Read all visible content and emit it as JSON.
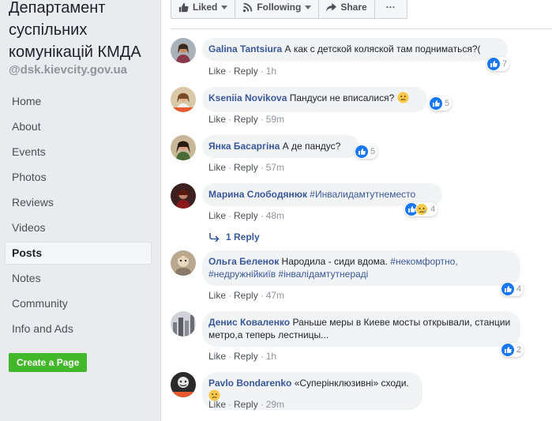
{
  "page": {
    "title": "Департамент суспільних комунікацій КМДА",
    "handle": "@dsk.kievcity.gov.ua"
  },
  "nav": {
    "home": "Home",
    "about": "About",
    "events": "Events",
    "photos": "Photos",
    "reviews": "Reviews",
    "videos": "Videos",
    "posts": "Posts",
    "notes": "Notes",
    "community": "Community",
    "info_ads": "Info and Ads",
    "active": "Posts"
  },
  "create_page_button": "Create a Page",
  "action_bar": {
    "liked": "Liked",
    "following": "Following",
    "share": "Share",
    "more": "···"
  },
  "colors": {
    "link": "#385898",
    "like_blue": "#1877f2",
    "create_green": "#42b72a",
    "bubble_bg": "#f2f3f5",
    "page_bg": "#e9ebee"
  },
  "comment_actions": {
    "like": "Like",
    "reply": "Reply",
    "separator": "·"
  },
  "comments": [
    {
      "author": "Galina Tantsiura",
      "text": "А как с детской коляской там подниматься?(",
      "time": "1h",
      "reactions": "7",
      "reaction_icons": [
        "like-icon"
      ]
    },
    {
      "author": "Kseniia Novikova",
      "text": "Пандуси не вписалися?",
      "time": "59m",
      "reactions": "5",
      "reaction_icons": [
        "like-icon"
      ],
      "emoji": "confused-face-emoji"
    },
    {
      "author": "Янка Басаргіна",
      "text": "А де пандус?",
      "time": "57m",
      "reactions": "5",
      "reaction_icons": [
        "like-icon"
      ]
    },
    {
      "author": "Марина Слободянюк",
      "tags": [
        "#Инвалидамтутнеместо"
      ],
      "time": "48m",
      "reactions": "4",
      "reaction_icons": [
        "like-icon",
        "sad-icon"
      ]
    },
    {
      "author": "Ольга Беленок",
      "text": "Народила - сиди вдома.",
      "tags": [
        "#некомфортно,",
        "#недружнійкиїв",
        "#інвалідамтутнераді"
      ],
      "time": "47m",
      "reactions": "4",
      "reaction_icons": [
        "like-icon"
      ]
    },
    {
      "author": "Денис Коваленко",
      "text": "Раньше меры в Киеве мосты открывали, станции метро,а теперь лестницы...",
      "time": "1h",
      "reactions": "2",
      "reaction_icons": [
        "like-icon"
      ]
    },
    {
      "author": "Pavlo Bondarenko",
      "text": "«Суперінклюзивні» сходи.",
      "time": "29m",
      "emoji": "confused-face-emoji"
    }
  ],
  "replies_link": "1 Reply"
}
